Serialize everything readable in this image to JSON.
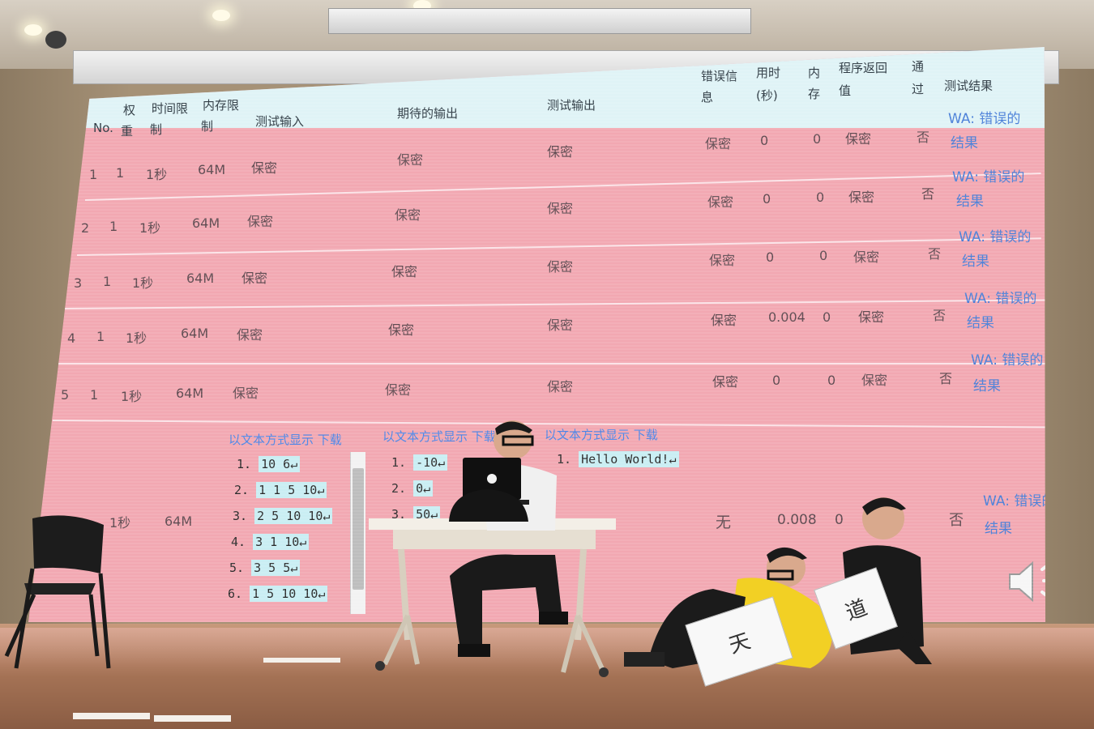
{
  "headers": {
    "no": "No.",
    "weight_1": "权",
    "weight_2": "重",
    "time_1": "时间限",
    "time_2": "制",
    "mem_1": "内存限",
    "mem_2": "制",
    "input": "测试输入",
    "expected": "期待的输出",
    "output": "测试输出",
    "err_1": "错误信",
    "err_2": "息",
    "time_used_1": "用时",
    "time_used_2": "(秒)",
    "mem_used_1": "内",
    "mem_used_2": "存",
    "ret_1": "程序返回",
    "ret_2": "值",
    "pass_1": "通",
    "pass_2": "过",
    "result": "测试结果"
  },
  "rows": [
    {
      "no": "1",
      "weight": "1",
      "time": "1秒",
      "mem": "64M",
      "input": "保密",
      "expected": "保密",
      "output": "保密",
      "err": "保密",
      "time_used": "0",
      "mem_used": "0",
      "ret": "保密",
      "pass": "否",
      "result_1": "WA: 错误的",
      "result_2": "结果"
    },
    {
      "no": "2",
      "weight": "1",
      "time": "1秒",
      "mem": "64M",
      "input": "保密",
      "expected": "保密",
      "output": "保密",
      "err": "保密",
      "time_used": "0",
      "mem_used": "0",
      "ret": "保密",
      "pass": "否",
      "result_1": "WA: 错误的",
      "result_2": "结果"
    },
    {
      "no": "3",
      "weight": "1",
      "time": "1秒",
      "mem": "64M",
      "input": "保密",
      "expected": "保密",
      "output": "保密",
      "err": "保密",
      "time_used": "0",
      "mem_used": "0",
      "ret": "保密",
      "pass": "否",
      "result_1": "WA: 错误的",
      "result_2": "结果"
    },
    {
      "no": "4",
      "weight": "1",
      "time": "1秒",
      "mem": "64M",
      "input": "保密",
      "expected": "保密",
      "output": "保密",
      "err": "保密",
      "time_used": "0.004",
      "mem_used": "0",
      "ret": "保密",
      "pass": "否",
      "result_1": "WA: 错误的",
      "result_2": "结果"
    },
    {
      "no": "5",
      "weight": "1",
      "time": "1秒",
      "mem": "64M",
      "input": "保密",
      "expected": "保密",
      "output": "保密",
      "err": "保密",
      "time_used": "0",
      "mem_used": "0",
      "ret": "保密",
      "pass": "否",
      "result_1": "WA: 错误的",
      "result_2": "结果"
    }
  ],
  "row6": {
    "time": "1秒",
    "mem": "64M",
    "err": "无",
    "time_used": "0.008",
    "mem_used": "0",
    "pass": "否",
    "result_1": "WA: 错误的",
    "result_2": "结果",
    "input_links": "以文本方式显示 下载",
    "expected_links": "以文本方式显示 下载",
    "output_links": "以文本方式显示 下载",
    "input_lines": [
      {
        "n": "1.",
        "v": "10 6↵"
      },
      {
        "n": "2.",
        "v": "1 1 5 10↵"
      },
      {
        "n": "3.",
        "v": "2 5 10 10↵"
      },
      {
        "n": "4.",
        "v": "3 1 10↵"
      },
      {
        "n": "5.",
        "v": "3 5 5↵"
      },
      {
        "n": "6.",
        "v": "1 5 10 10↵"
      }
    ],
    "expected_lines": [
      {
        "n": "1.",
        "v": "-10↵"
      },
      {
        "n": "2.",
        "v": "0↵"
      },
      {
        "n": "3.",
        "v": "50↵"
      }
    ],
    "output_lines": [
      {
        "n": "1.",
        "v": "Hello World!↵"
      }
    ]
  },
  "sign_a": "天",
  "sign_b": "道",
  "icons": {
    "speaker": "speaker-icon",
    "laptop_logo": "apple-logo-icon"
  },
  "colors": {
    "row_bg": "#f2a8b2",
    "header_bg": "#dff3f6",
    "link": "#4a7fd8"
  }
}
